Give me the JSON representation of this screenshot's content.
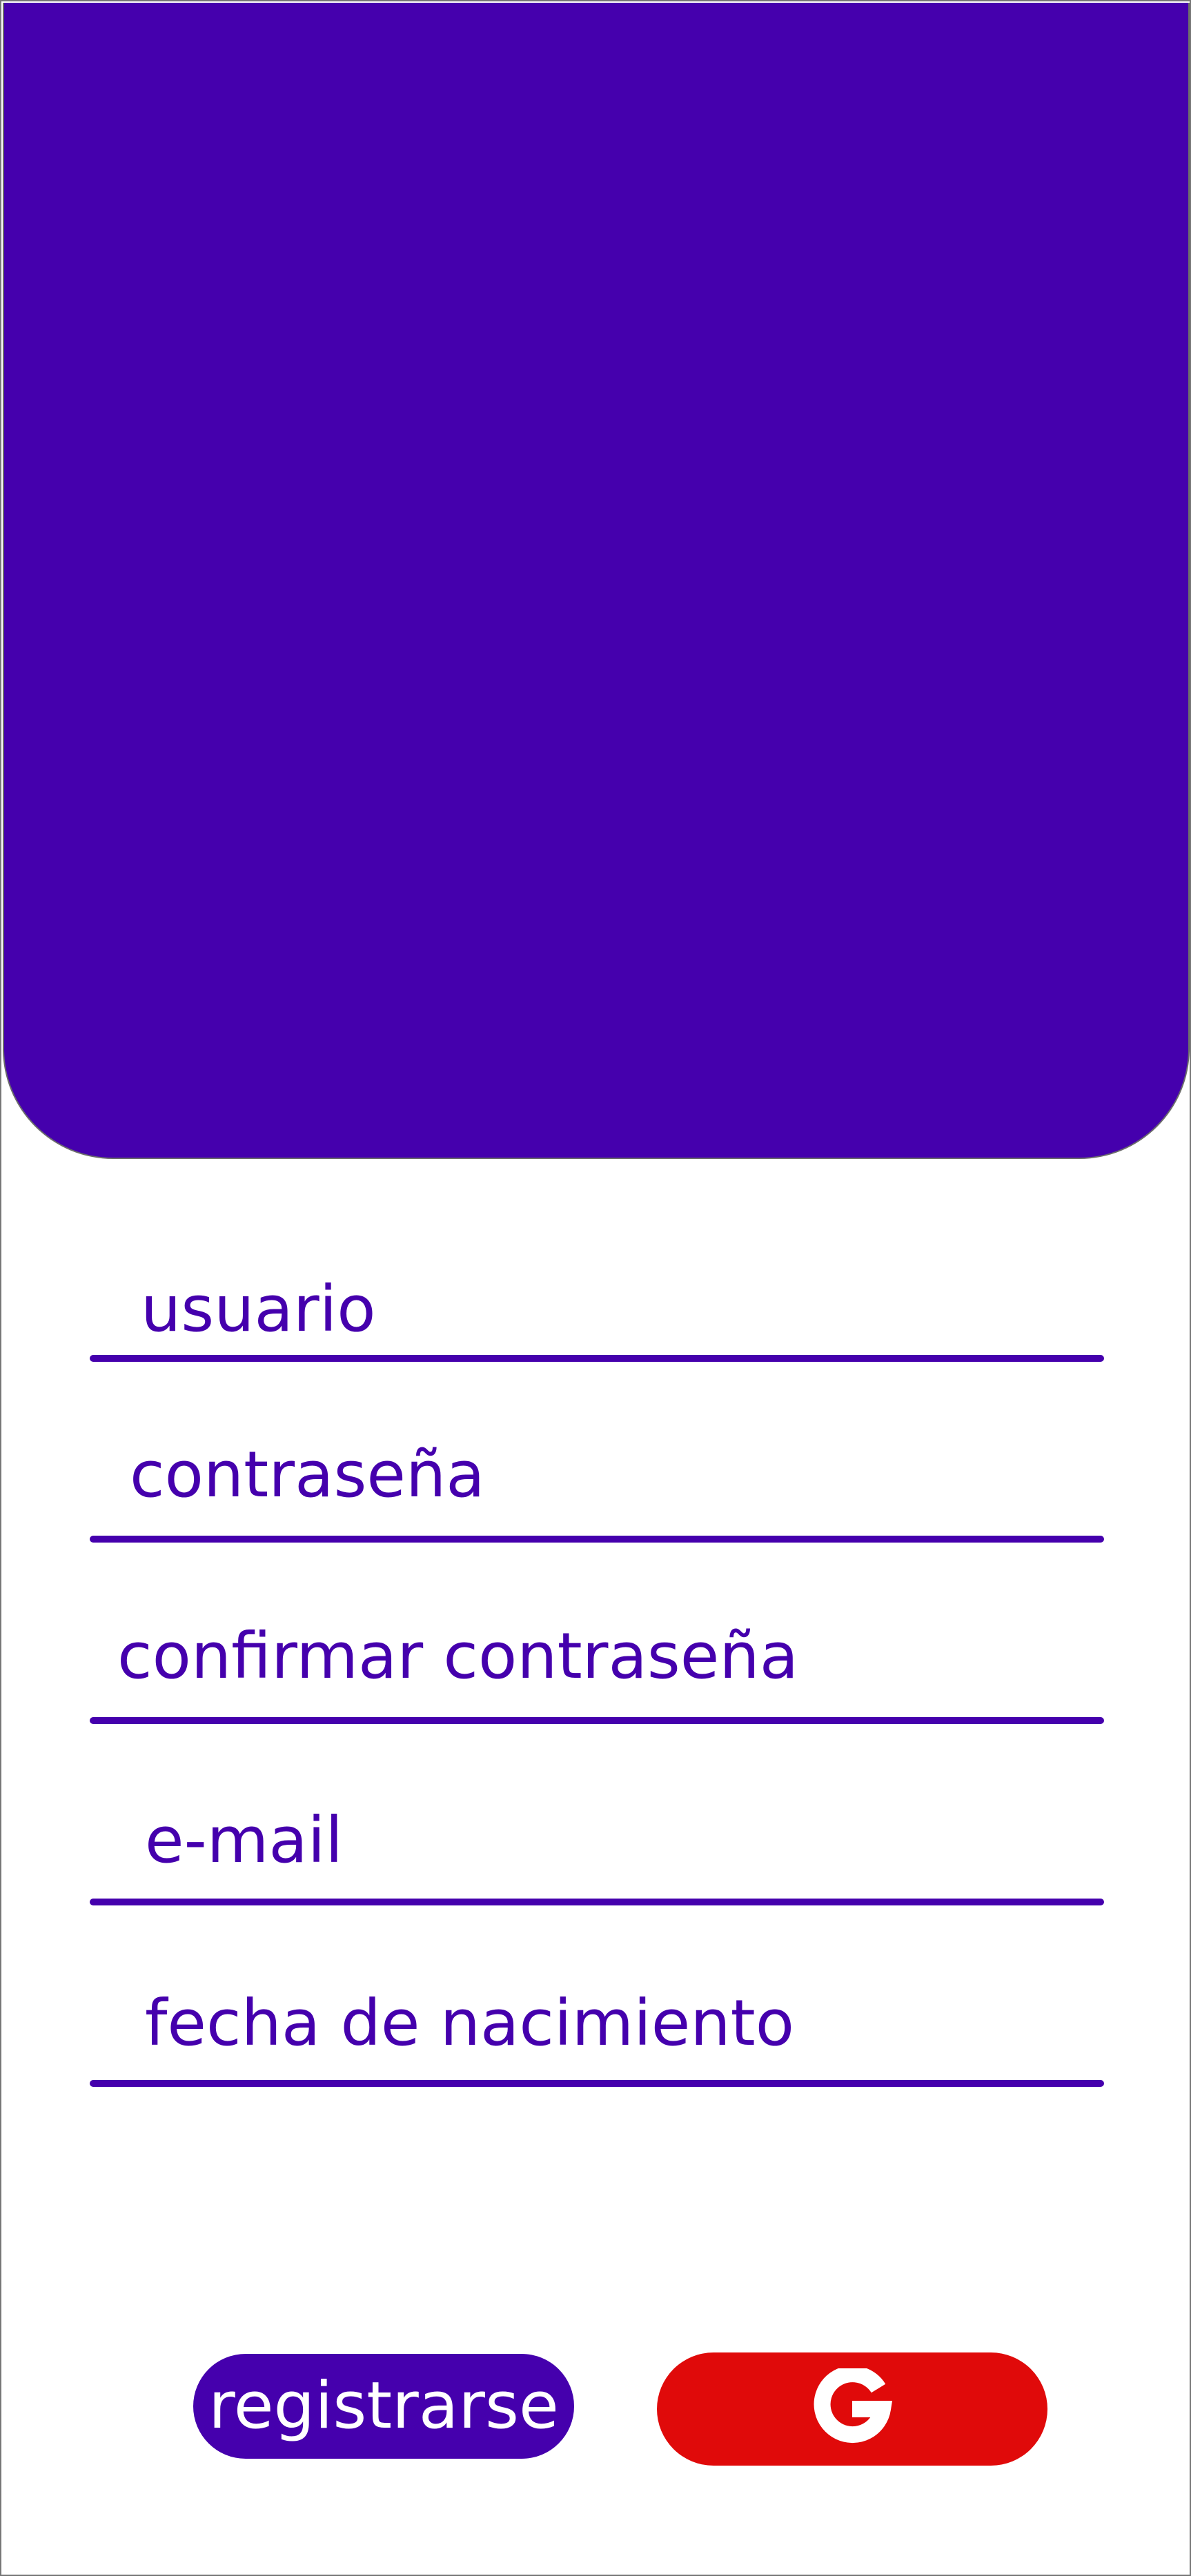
{
  "theme": {
    "primary": "#4500ad",
    "google_red": "#e00a0a",
    "background": "#ffffff",
    "border": "#777777"
  },
  "form": {
    "fields": [
      {
        "placeholder": "usuario"
      },
      {
        "placeholder": "contraseña"
      },
      {
        "placeholder": "confirmar contraseña"
      },
      {
        "placeholder": "e-mail"
      },
      {
        "placeholder": "fecha de nacimiento"
      }
    ]
  },
  "actions": {
    "register_label": "registrarse",
    "google_icon": "google-g-icon"
  }
}
